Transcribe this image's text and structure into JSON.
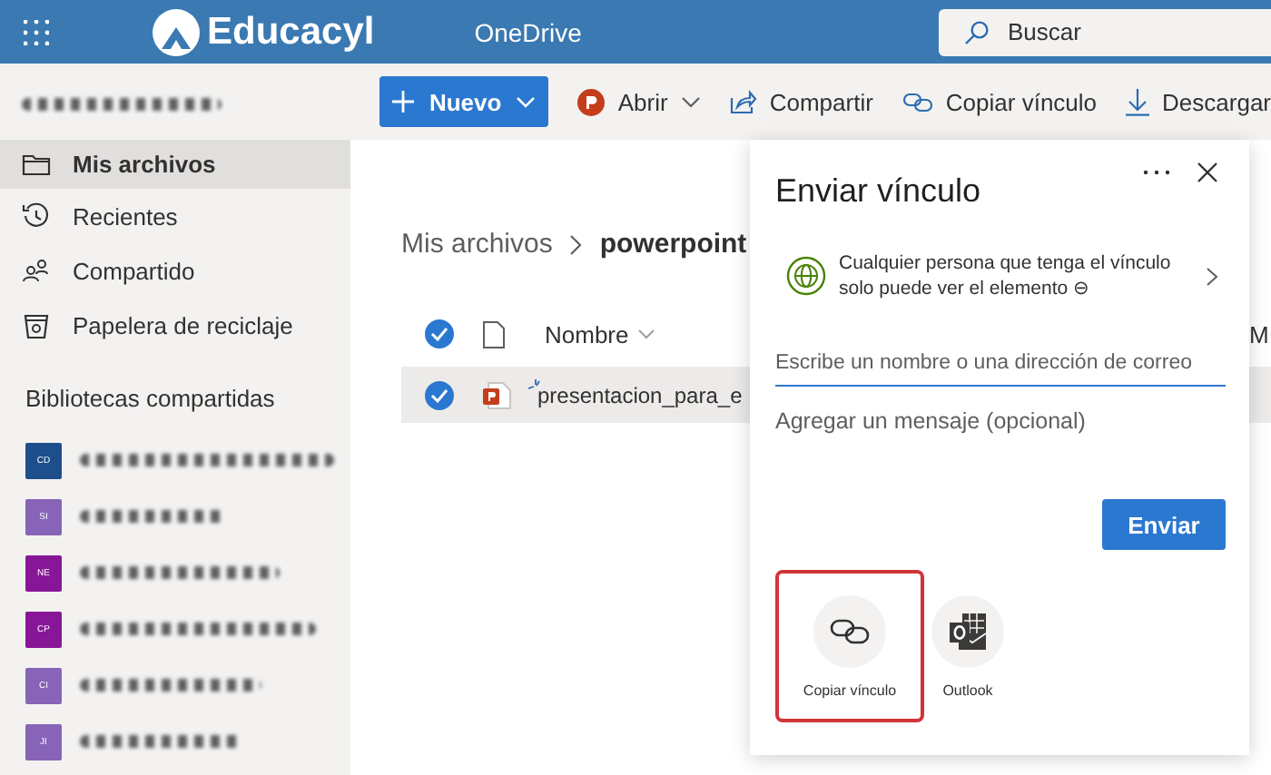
{
  "app_bar": {
    "brand": "Educacyl",
    "app_name": "OneDrive",
    "search": {
      "placeholder": "Buscar"
    }
  },
  "command_bar": {
    "new_button": "Nuevo",
    "actions": [
      {
        "kind": "powerpoint",
        "label": "Abrir",
        "dropdown": true
      },
      {
        "kind": "share",
        "label": "Compartir",
        "dropdown": false
      },
      {
        "kind": "link",
        "label": "Copiar vínculo",
        "dropdown": false
      },
      {
        "kind": "download",
        "label": "Descargar",
        "dropdown": false
      }
    ]
  },
  "sidebar": {
    "items": [
      {
        "kind": "folder",
        "label": "Mis archivos",
        "selected": true
      },
      {
        "kind": "recent",
        "label": "Recientes",
        "selected": false
      },
      {
        "kind": "shared",
        "label": "Compartido",
        "selected": false
      },
      {
        "kind": "bin",
        "label": "Papelera de reciclaje",
        "selected": false
      }
    ],
    "section_title": "Bibliotecas compartidas",
    "libraries": [
      {
        "initials": "CD",
        "color": "#1f4e8c"
      },
      {
        "initials": "SI",
        "color": "#8764b8"
      },
      {
        "initials": "NE",
        "color": "#881798"
      },
      {
        "initials": "CP",
        "color": "#881798"
      },
      {
        "initials": "CI",
        "color": "#8764b8"
      },
      {
        "initials": "JI",
        "color": "#8764b8"
      }
    ]
  },
  "main": {
    "breadcrumb": [
      "Mis archivos",
      "powerpoint"
    ],
    "table": {
      "all_selected": true,
      "columns": [
        "Nombre",
        "M"
      ],
      "rows": [
        {
          "name": "presentacion_para_e",
          "selected": true
        }
      ]
    }
  },
  "share_panel": {
    "title": "Enviar vínculo",
    "link_setting": "Cualquier persona que tenga el vínculo solo puede ver el elemento ⊖",
    "recipient_field": {
      "placeholder": "Escribe un nombre o una dirección de correo"
    },
    "message_field": {
      "placeholder": "Agregar un mensaje (opcional)"
    },
    "send_button": "Enviar",
    "options": [
      {
        "kind": "link",
        "label": "Copiar vínculo",
        "selected": true
      },
      {
        "kind": "outlook",
        "label": "Outlook",
        "selected": false
      }
    ]
  }
}
